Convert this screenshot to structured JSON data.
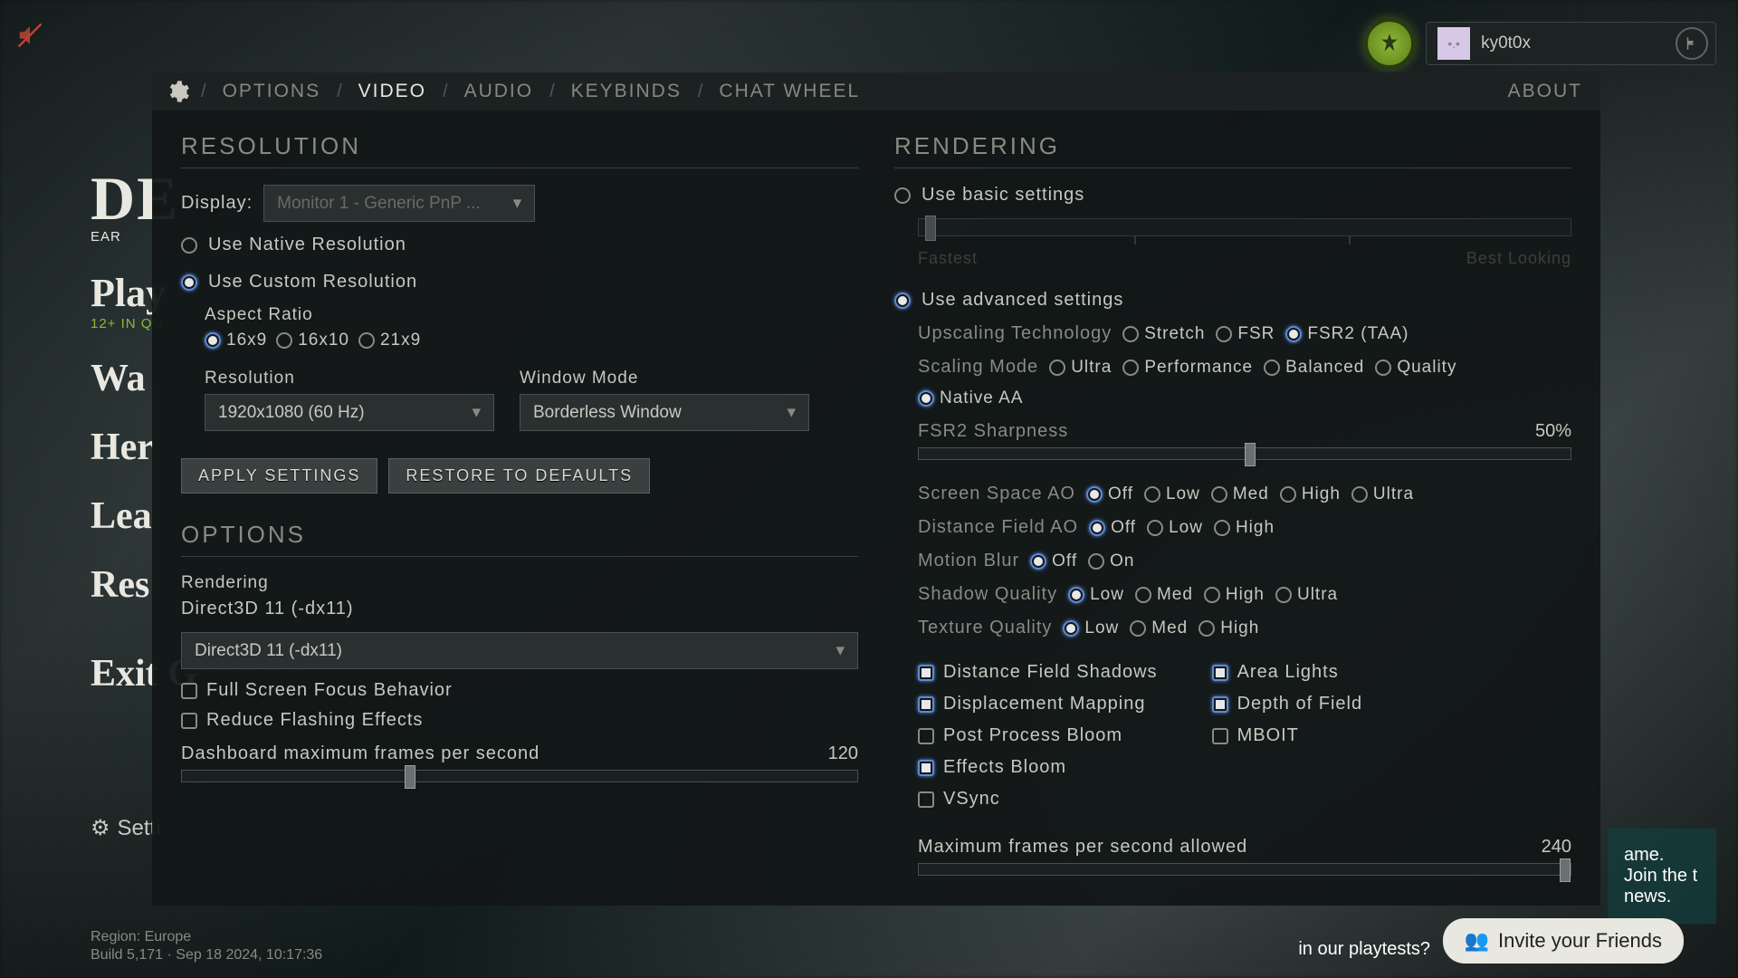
{
  "user": {
    "name": "ky0t0x"
  },
  "tabs": {
    "options": "OPTIONS",
    "video": "VIDEO",
    "audio": "AUDIO",
    "keybinds": "KEYBINDS",
    "chatwheel": "CHAT WHEEL",
    "about": "ABOUT"
  },
  "bgMenu": {
    "logo": "DE",
    "sub": "EAR",
    "play": "Play",
    "playSub": "12+ IN QU",
    "watch": "Wa",
    "heroes": "Her",
    "learn": "Lea",
    "resources": "Res",
    "exit": "Exit G",
    "settings": "Setti",
    "region": "Region: Europe",
    "build": "Build 5,171 · Sep 18 2024, 10:17:36"
  },
  "resolution": {
    "title": "RESOLUTION",
    "displayLabel": "Display:",
    "displayValue": "Monitor 1 - Generic PnP ...",
    "useNative": "Use Native Resolution",
    "useCustom": "Use Custom Resolution",
    "aspectRatio": {
      "label": "Aspect Ratio",
      "o1": "16x9",
      "o2": "16x10",
      "o3": "21x9"
    },
    "res": {
      "label": "Resolution",
      "value": "1920x1080 (60 Hz)"
    },
    "windowMode": {
      "label": "Window Mode",
      "value": "Borderless Window"
    },
    "apply": "APPLY SETTINGS",
    "restore": "RESTORE TO DEFAULTS"
  },
  "options": {
    "title": "OPTIONS",
    "renderingLabel": "Rendering",
    "renderingValue": "Direct3D 11 (-dx11)",
    "rendererSelect": "Direct3D 11 (-dx11)",
    "fullscreenFocus": "Full Screen Focus Behavior",
    "reduceFlashing": "Reduce Flashing Effects",
    "dashFps": {
      "label": "Dashboard maximum frames per second",
      "value": "120"
    }
  },
  "rendering": {
    "title": "RENDERING",
    "basic": "Use basic settings",
    "basicLeft": "Fastest",
    "basicRight": "Best Looking",
    "advanced": "Use advanced settings",
    "upscaling": {
      "label": "Upscaling Technology",
      "o1": "Stretch",
      "o2": "FSR",
      "o3": "FSR2 (TAA)"
    },
    "scaling": {
      "label": "Scaling Mode",
      "o1": "Ultra",
      "o2": "Performance",
      "o3": "Balanced",
      "o4": "Quality",
      "o5": "Native AA"
    },
    "sharpness": {
      "label": "FSR2 Sharpness",
      "value": "50%"
    },
    "ssao": {
      "label": "Screen Space AO",
      "o1": "Off",
      "o2": "Low",
      "o3": "Med",
      "o4": "High",
      "o5": "Ultra"
    },
    "dfao": {
      "label": "Distance Field AO",
      "o1": "Off",
      "o2": "Low",
      "o3": "High"
    },
    "motionBlur": {
      "label": "Motion Blur",
      "o1": "Off",
      "o2": "On"
    },
    "shadow": {
      "label": "Shadow Quality",
      "o1": "Low",
      "o2": "Med",
      "o3": "High",
      "o4": "Ultra"
    },
    "texture": {
      "label": "Texture Quality",
      "o1": "Low",
      "o2": "Med",
      "o3": "High"
    },
    "checks": {
      "dfs": "Distance Field Shadows",
      "disp": "Displacement Mapping",
      "ppbloom": "Post Process Bloom",
      "effbloom": "Effects Bloom",
      "vsync": "VSync",
      "area": "Area Lights",
      "dof": "Depth of Field",
      "mboit": "MBOIT"
    },
    "maxFps": {
      "label": "Maximum frames per second allowed",
      "value": "240"
    }
  },
  "banner": {
    "joinText": "ame. Join the t news.",
    "playtest": "in our playtests?",
    "invite": "Invite your Friends"
  }
}
